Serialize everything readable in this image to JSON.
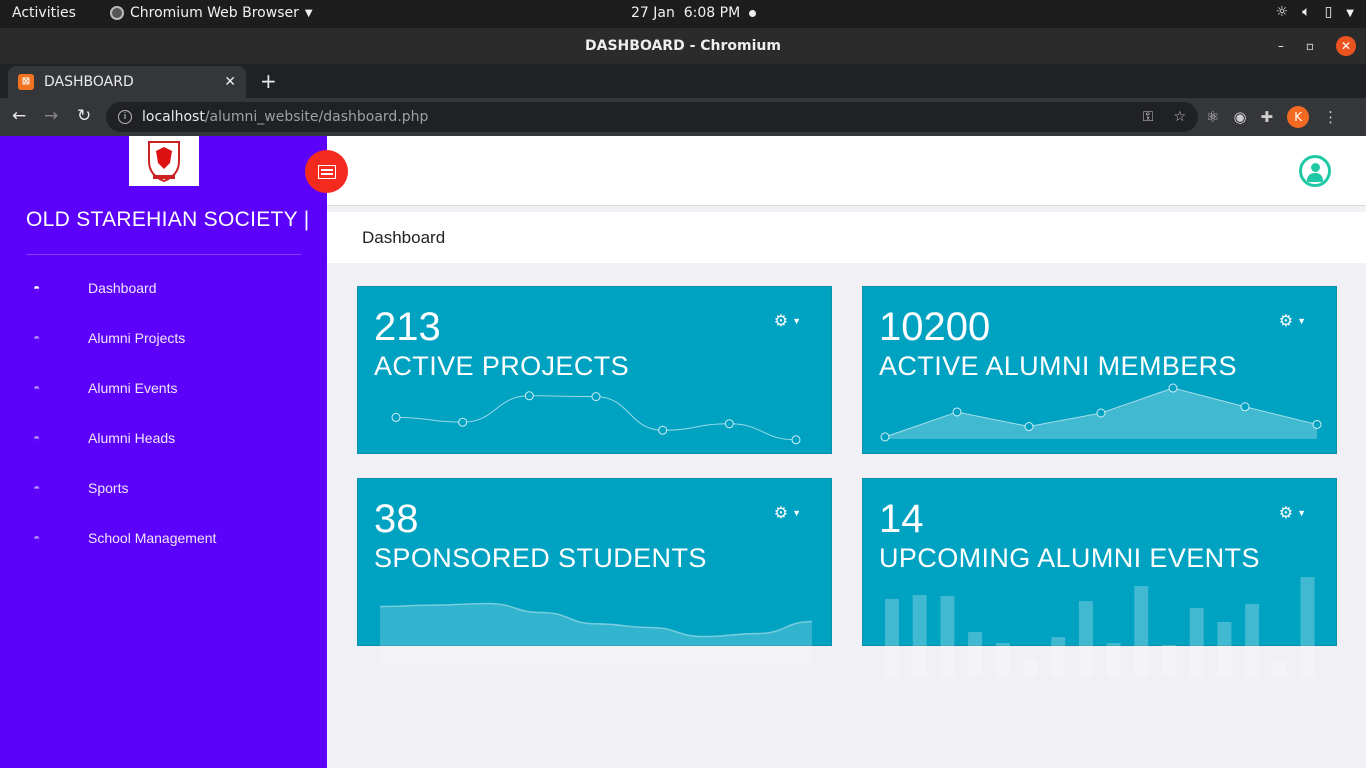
{
  "os": {
    "activities": "Activities",
    "app_name": "Chromium Web Browser",
    "date": "27 Jan",
    "time": "6:08 PM"
  },
  "window": {
    "title": "DASHBOARD - Chromium"
  },
  "tab": {
    "title": "DASHBOARD"
  },
  "address": {
    "host": "localhost",
    "path": "/alumni_website/dashboard.php"
  },
  "profile_initial": "K",
  "sidebar": {
    "brand": "OLD STAREHIAN SOCIETY |",
    "items": [
      {
        "label": "Dashboard"
      },
      {
        "label": "Alumni Projects"
      },
      {
        "label": "Alumni Events"
      },
      {
        "label": "Alumni Heads"
      },
      {
        "label": "Sports"
      },
      {
        "label": "School Management"
      }
    ]
  },
  "breadcrumb": "Dashboard",
  "cards": [
    {
      "value": "213",
      "label": "ACTIVE PROJECTS",
      "chart": "line",
      "points": [
        3.2,
        2.6,
        5.9,
        5.8,
        1.6,
        2.4,
        0.4
      ]
    },
    {
      "value": "10200",
      "label": "ACTIVE ALUMNI MEMBERS",
      "chart": "area",
      "points": [
        0.2,
        2.6,
        1.2,
        2.5,
        4.9,
        3.1,
        1.4
      ]
    },
    {
      "value": "38",
      "label": "SPONSORED STUDENTS",
      "chart": "smooth-area",
      "points": [
        78,
        80,
        82,
        70,
        55,
        50,
        38,
        42,
        58
      ]
    },
    {
      "value": "14",
      "label": "UPCOMING ALUMNI EVENTS",
      "chart": "bars",
      "points": [
        78,
        82,
        81,
        45,
        34,
        18,
        40,
        76,
        34,
        91,
        32,
        69,
        55,
        73,
        17,
        100
      ]
    }
  ],
  "colors": {
    "sidebar": "#5c02fb",
    "card": "#00a2c2",
    "toggle": "#f42a1e",
    "user_icon": "#20c9a6"
  }
}
